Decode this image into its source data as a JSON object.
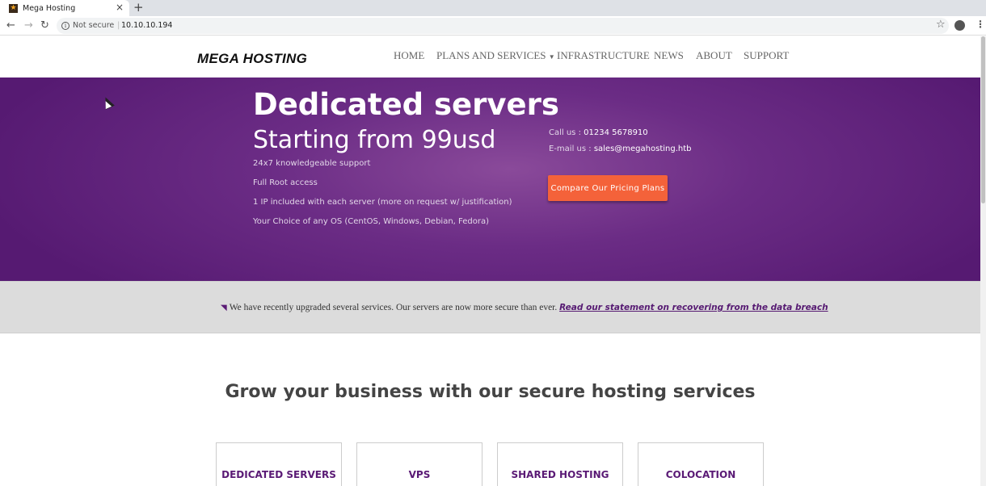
{
  "browser": {
    "tab_title": "Mega Hosting",
    "tab_close": "×",
    "new_tab": "+",
    "security_label": "Not secure",
    "url": "10.10.10.194"
  },
  "nav": {
    "logo": "MEGA HOSTING",
    "items": [
      {
        "label": "HOME"
      },
      {
        "label": "PLANS AND SERVICES",
        "has_dropdown": true
      },
      {
        "label": "INFRASTRUCTURE"
      },
      {
        "label": "NEWS"
      },
      {
        "label": "ABOUT"
      },
      {
        "label": "SUPPORT"
      }
    ]
  },
  "hero": {
    "title": "Dedicated servers",
    "subtitle": "Starting from 99usd",
    "features": [
      "24x7 knowledgeable support",
      "Full Root access",
      "1 IP included with each server (more on request w/ justification)",
      "Your Choice of any OS (CentOS, Windows, Debian, Fedora)"
    ],
    "call_label": "Call us : ",
    "call_value": "01234 5678910",
    "email_label": "E-mail us : ",
    "email_value": "sales@megahosting.htb",
    "cta_label": "Compare Our Pricing Plans"
  },
  "notice": {
    "text": "We have recently upgraded several services. Our servers are now more secure than ever.",
    "link": "Read our statement on recovering from the data breach"
  },
  "services": {
    "heading": "Grow your business with our secure hosting services",
    "cards": [
      {
        "title": "DEDICATED SERVERS"
      },
      {
        "title": "VPS"
      },
      {
        "title": "SHARED HOSTING"
      },
      {
        "title": "COLOCATION"
      }
    ]
  },
  "colors": {
    "brand_purple": "#561a72",
    "cta_orange": "#f4623a",
    "notice_bg": "#dcdcdc"
  }
}
